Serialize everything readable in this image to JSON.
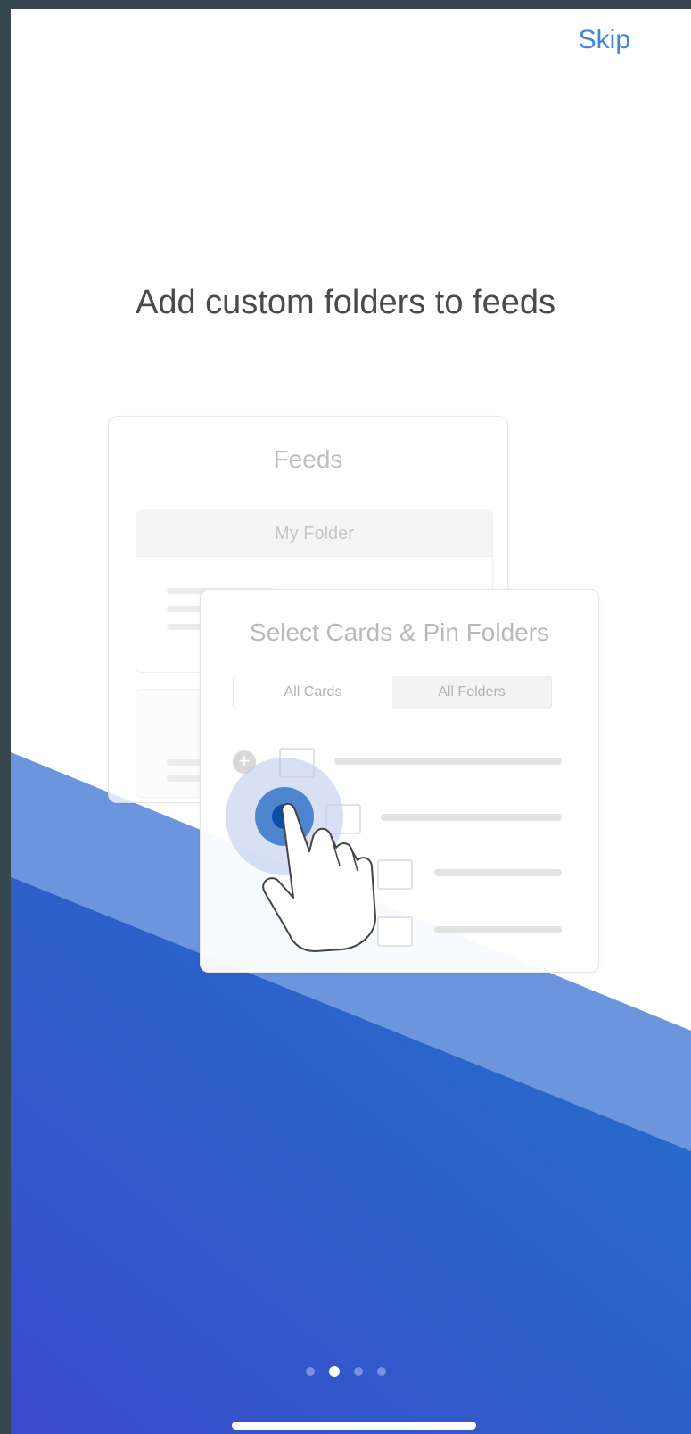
{
  "header": {
    "skip_label": "Skip"
  },
  "onboarding": {
    "title": "Add custom folders to feeds",
    "page_count": 4,
    "current_page": 2
  },
  "illustration": {
    "feeds_card": {
      "title": "Feeds",
      "folder_label": "My Folder"
    },
    "select_card": {
      "title": "Select Cards & Pin Folders",
      "tabs": [
        "All Cards",
        "All Folders"
      ]
    }
  },
  "colors": {
    "accent": "#3f86d6",
    "title_text": "#4a4a4a",
    "wave_light": "#6b96de",
    "gradient_start": "#3a4bcc",
    "gradient_end": "#2273c8"
  },
  "icons": {
    "tap_hand": "hand-pointer-icon",
    "add_circle": "plus-circle-icon",
    "folder": "folder-icon",
    "mail": "mail-icon"
  }
}
